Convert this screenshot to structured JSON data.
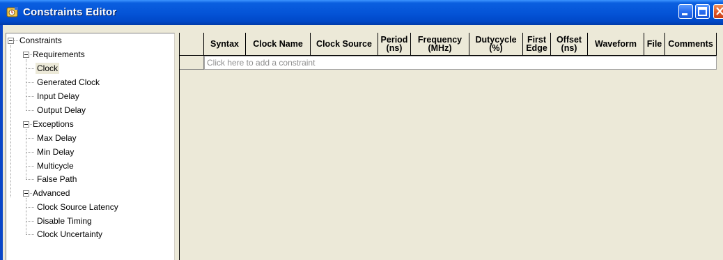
{
  "window": {
    "title": "Constraints Editor"
  },
  "tree": {
    "root": "Constraints",
    "groups": [
      {
        "label": "Requirements",
        "items": [
          "Clock",
          "Generated Clock",
          "Input Delay",
          "Output Delay"
        ]
      },
      {
        "label": "Exceptions",
        "items": [
          "Max Delay",
          "Min Delay",
          "Multicycle",
          "False Path"
        ]
      },
      {
        "label": "Advanced",
        "items": [
          "Clock Source Latency",
          "Disable Timing",
          "Clock Uncertainty"
        ]
      }
    ],
    "selected": "Clock"
  },
  "grid": {
    "columns": [
      {
        "label": "Syntax"
      },
      {
        "label": "Clock Name"
      },
      {
        "label": "Clock Source"
      },
      {
        "label": "Period",
        "sub": "(ns)"
      },
      {
        "label": "Frequency",
        "sub": "(MHz)"
      },
      {
        "label": "Dutycycle",
        "sub": "(%)"
      },
      {
        "label": "First",
        "sub": "Edge"
      },
      {
        "label": "Offset",
        "sub": "(ns)"
      },
      {
        "label": "Waveform"
      },
      {
        "label": "File"
      },
      {
        "label": "Comments"
      }
    ],
    "add_row_placeholder": "Click here to add a constraint"
  },
  "colors": {
    "title_bar": "#0453d6",
    "frame": "#ece9d8",
    "close_button": "#e45a2a"
  }
}
